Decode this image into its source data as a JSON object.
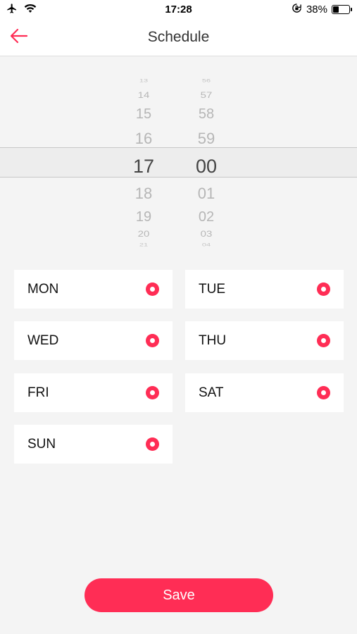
{
  "status_bar": {
    "time": "17:28",
    "battery_percent": "38%",
    "battery_level": 0.38,
    "icons": [
      "airplane-icon",
      "wifi-icon",
      "orientation-lock-icon",
      "battery-icon"
    ]
  },
  "nav": {
    "title": "Schedule",
    "back_icon": "arrow-left-icon"
  },
  "picker": {
    "hours": [
      "13",
      "14",
      "15",
      "16",
      "17",
      "18",
      "19",
      "20",
      "21"
    ],
    "minutes": [
      "56",
      "57",
      "58",
      "59",
      "00",
      "01",
      "02",
      "03",
      "04"
    ],
    "selected_hour": "17",
    "selected_minute": "00"
  },
  "days": [
    {
      "label": "MON",
      "selected": true
    },
    {
      "label": "TUE",
      "selected": true
    },
    {
      "label": "WED",
      "selected": true
    },
    {
      "label": "THU",
      "selected": true
    },
    {
      "label": "FRI",
      "selected": true
    },
    {
      "label": "SAT",
      "selected": true
    },
    {
      "label": "SUN",
      "selected": true
    }
  ],
  "save_label": "Save",
  "colors": {
    "accent": "#ff2d55",
    "background": "#f4f4f4",
    "card": "#ffffff"
  }
}
